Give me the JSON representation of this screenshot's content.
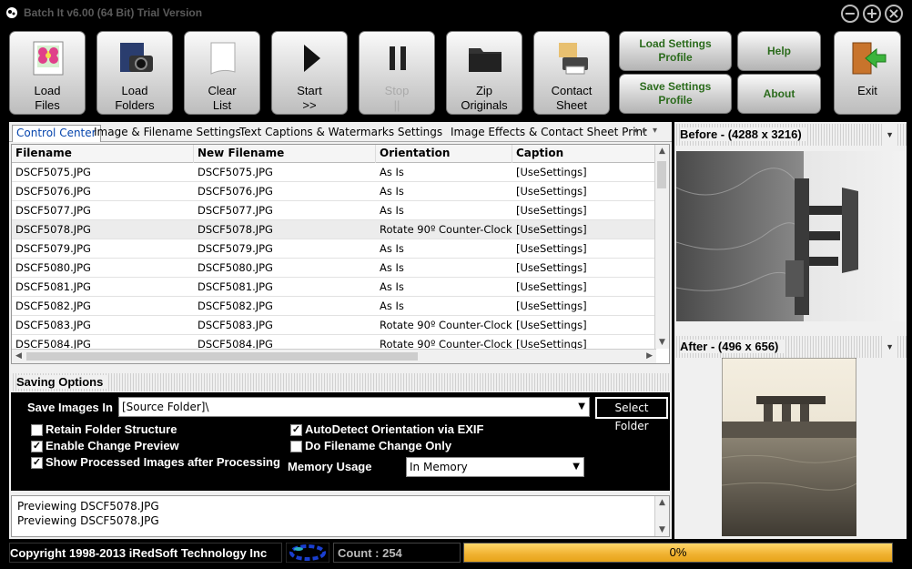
{
  "window": {
    "title": "Batch It v6.00 (64 Bit) Trial Version"
  },
  "window_controls": {
    "minimize": "−",
    "maximize": "+",
    "close": "×"
  },
  "toolbar": {
    "load_files": "Load\nFiles",
    "load_folders": "Load\nFolders",
    "clear_list": "Clear\nList",
    "start": "Start\n>>",
    "stop": "Stop\n||",
    "zip_originals": "Zip\nOriginals",
    "contact_sheet": "Contact\nSheet",
    "load_settings_profile": "Load Settings\nProfile",
    "save_settings_profile": "Save Settings\nProfile",
    "help": "Help",
    "about": "About",
    "exit": "Exit"
  },
  "tabs": [
    "Control Center",
    "Image & Filename Settings",
    "Text Captions & Watermarks Settings",
    "Image Effects & Contact Sheet Print"
  ],
  "grid": {
    "columns": [
      "Filename",
      "New Filename",
      "Orientation",
      "Caption"
    ],
    "rows": [
      [
        "DSCF5075.JPG",
        "DSCF5075.JPG",
        "As Is",
        "[UseSettings]"
      ],
      [
        "DSCF5076.JPG",
        "DSCF5076.JPG",
        "As Is",
        "[UseSettings]"
      ],
      [
        "DSCF5077.JPG",
        "DSCF5077.JPG",
        "As Is",
        "[UseSettings]"
      ],
      [
        "DSCF5078.JPG",
        "DSCF5078.JPG",
        "Rotate 90º Counter-Clock...",
        "[UseSettings]"
      ],
      [
        "DSCF5079.JPG",
        "DSCF5079.JPG",
        "As Is",
        "[UseSettings]"
      ],
      [
        "DSCF5080.JPG",
        "DSCF5080.JPG",
        "As Is",
        "[UseSettings]"
      ],
      [
        "DSCF5081.JPG",
        "DSCF5081.JPG",
        "As Is",
        "[UseSettings]"
      ],
      [
        "DSCF5082.JPG",
        "DSCF5082.JPG",
        "As Is",
        "[UseSettings]"
      ],
      [
        "DSCF5083.JPG",
        "DSCF5083.JPG",
        "Rotate 90º Counter-Clock...",
        "[UseSettings]"
      ],
      [
        "DSCF5084.JPG",
        "DSCF5084.JPG",
        "Rotate 90º Counter-Clock...",
        "[UseSettings]"
      ]
    ],
    "selected_row": 3
  },
  "saving_options": {
    "title": "Saving Options",
    "save_images_in_label": "Save Images In",
    "save_images_in_value": "[Source Folder]\\",
    "select_folder": "Select Folder",
    "retain_folder_structure": {
      "label": "Retain Folder Structure",
      "checked": false
    },
    "enable_change_preview": {
      "label": "Enable Change Preview",
      "checked": true
    },
    "show_processed_images": {
      "label": "Show Processed Images after Processing",
      "checked": true
    },
    "autodetect_orientation": {
      "label": "AutoDetect Orientation via EXIF",
      "checked": true
    },
    "do_filename_change_only": {
      "label": "Do Filename Change Only",
      "checked": false
    },
    "memory_usage_label": "Memory Usage",
    "memory_usage_value": "In Memory"
  },
  "log": {
    "lines": [
      "Previewing DSCF5078.JPG",
      "Previewing DSCF5078.JPG"
    ]
  },
  "preview": {
    "before_label": "Before - (4288 x 3216)",
    "after_label": "After - (496 x 656)"
  },
  "status": {
    "copyright": "Copyright 1998-2013 iRedSoft Technology Inc",
    "count": "Count : 254",
    "progress_text": "0%",
    "progress_value": 0
  }
}
